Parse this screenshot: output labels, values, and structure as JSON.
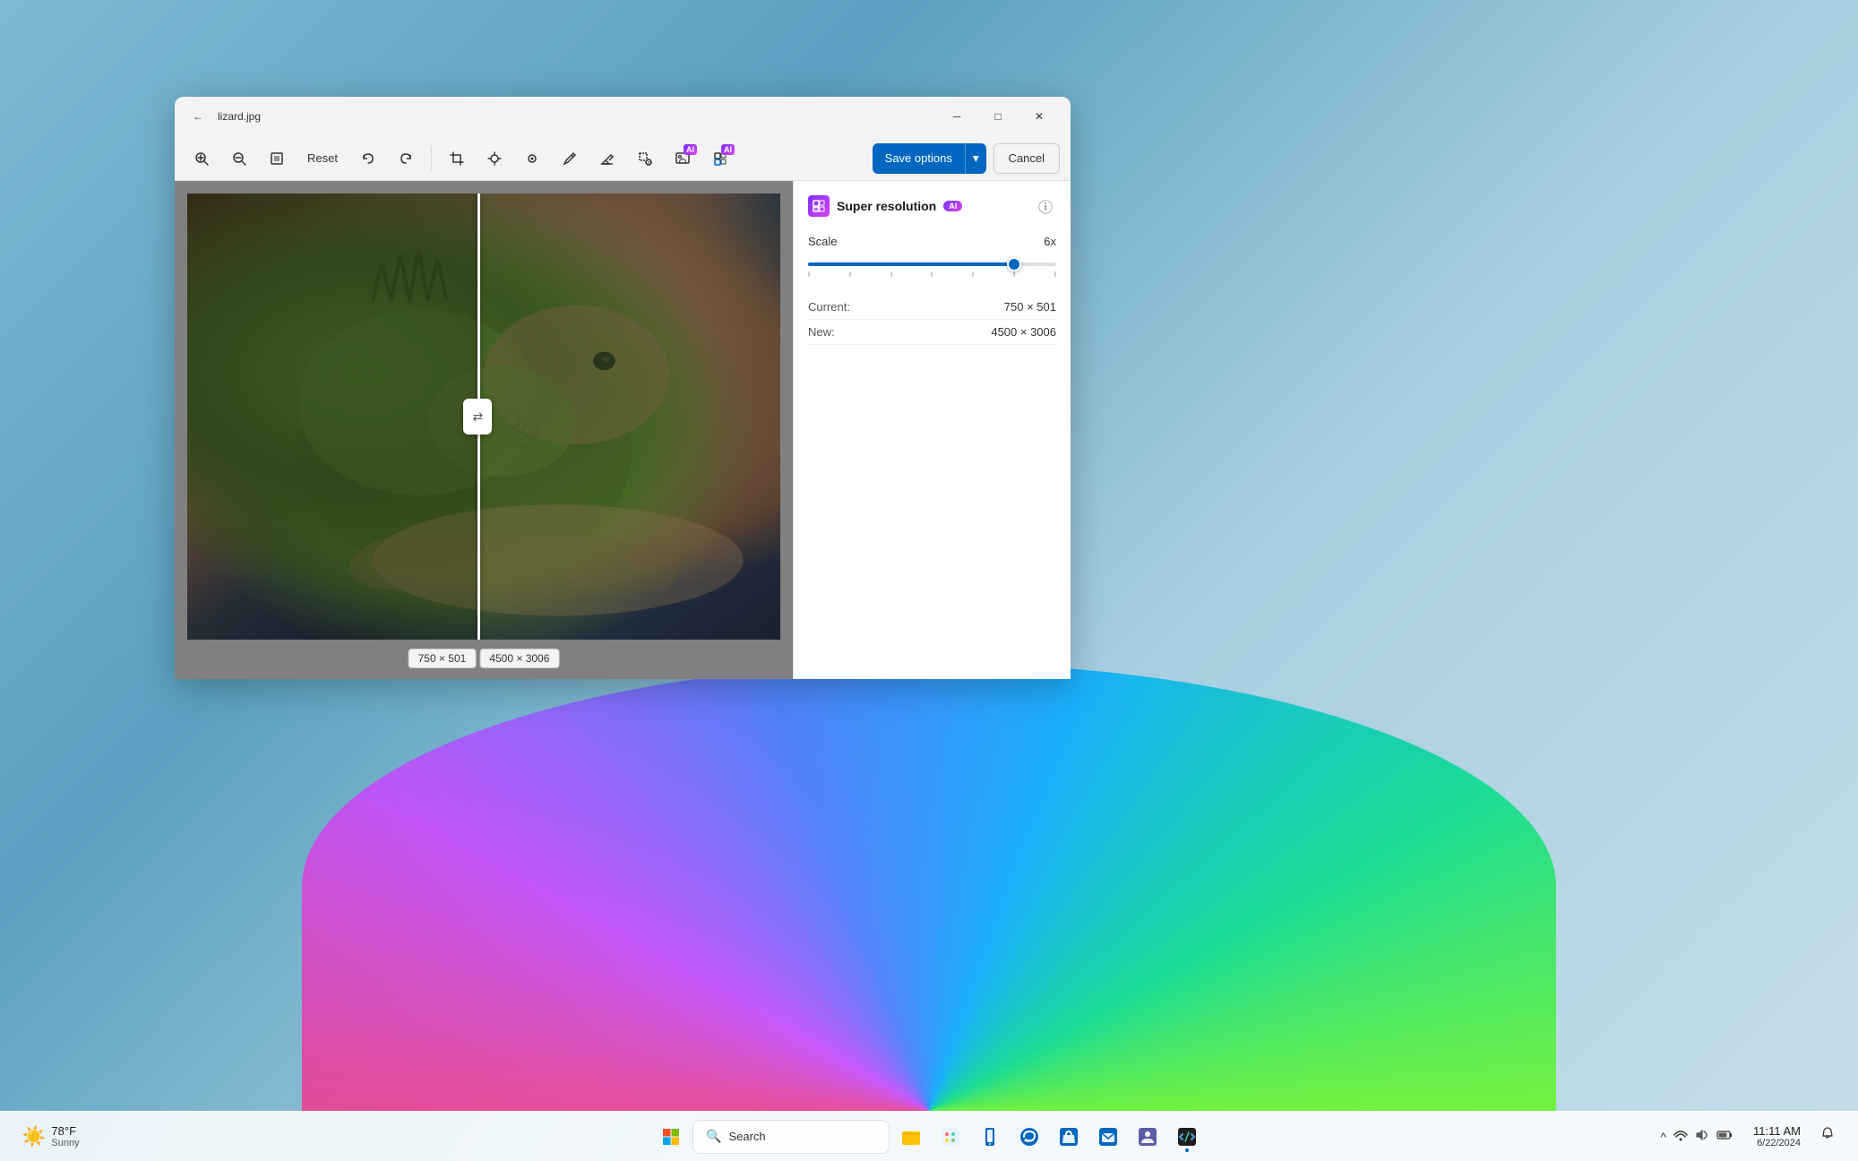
{
  "window": {
    "title": "lizard.jpg",
    "back_btn": "←",
    "minimize": "─",
    "maximize": "□",
    "close": "✕"
  },
  "toolbar": {
    "zoom_in": "🔍+",
    "zoom_out": "🔍−",
    "fit": "⊡",
    "reset": "Reset",
    "undo": "↩",
    "redo": "↪",
    "crop": "⊹",
    "exposure": "☀",
    "spot": "⊕",
    "draw": "✏",
    "erase": "◻",
    "special": "⧨",
    "ai_tool1": "🖼",
    "ai_tool2": "🔮",
    "save_options": "Save options",
    "dropdown_arrow": "▾",
    "cancel": "Cancel"
  },
  "panel": {
    "title": "Super resolution",
    "ai_label": "AI",
    "info_icon": "ⓘ",
    "scale_label": "Scale",
    "scale_value": "6x",
    "slider_percent": 83,
    "current_label": "Current:",
    "current_value": "750 × 501",
    "new_label": "New:",
    "new_value": "4500 × 3006"
  },
  "canvas": {
    "left_label": "750 × 501",
    "right_label": "4500 × 3006"
  },
  "taskbar": {
    "weather_icon": "☀",
    "weather_temp": "78°F",
    "weather_desc": "Sunny",
    "search_placeholder": "Search",
    "clock_time": "11:11 AM",
    "clock_date": "6/22/2024",
    "apps": [
      {
        "name": "start",
        "icon": "⊞"
      },
      {
        "name": "search",
        "icon": "🔍",
        "label": "Search"
      },
      {
        "name": "file-explorer",
        "icon": "📁"
      },
      {
        "name": "paint",
        "icon": "🎨"
      },
      {
        "name": "phone-link",
        "icon": "📱"
      },
      {
        "name": "edge",
        "icon": "🌐"
      },
      {
        "name": "store",
        "icon": "🛍"
      },
      {
        "name": "mail",
        "icon": "📧"
      },
      {
        "name": "teams",
        "icon": "👥"
      },
      {
        "name": "devtools",
        "icon": "💻"
      }
    ],
    "sys_tray": {
      "chevron": "^",
      "wifi": "WiFi",
      "volume": "🔊",
      "battery": "🔋",
      "notification": "🔔"
    }
  }
}
